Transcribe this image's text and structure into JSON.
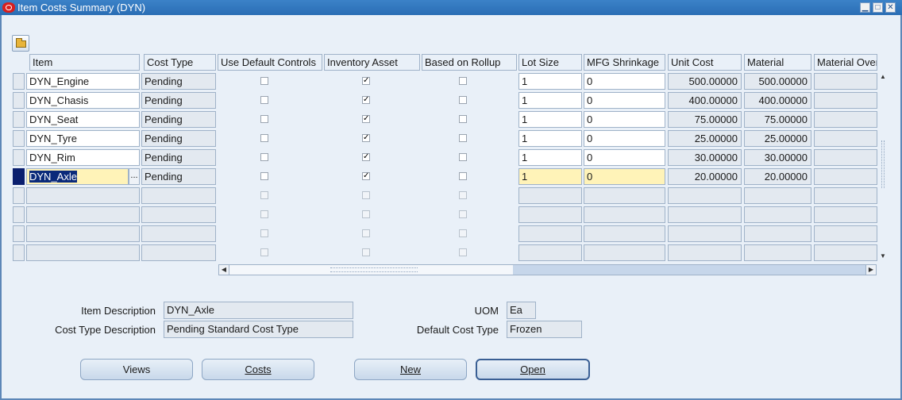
{
  "window": {
    "title": "Item Costs Summary (DYN)",
    "buttons": {
      "minimize": "▁",
      "maximize": "□",
      "close": "✕"
    }
  },
  "toolbar": {
    "open_folder_icon": "folder-open-icon"
  },
  "grid": {
    "headers": {
      "item": "Item",
      "cost_type": "Cost Type",
      "use_default_controls": "Use Default Controls",
      "inventory_asset": "Inventory Asset",
      "based_on_rollup": "Based on Rollup",
      "lot_size": "Lot Size",
      "mfg_shrinkage": "MFG Shrinkage",
      "unit_cost": "Unit Cost",
      "material": "Material",
      "material_overhead": "Material Over"
    },
    "rows": [
      {
        "item": "DYN_Engine",
        "cost_type": "Pending",
        "use_default_controls": false,
        "inventory_asset": true,
        "based_on_rollup": false,
        "lot_size": "1",
        "mfg_shrinkage": "0",
        "unit_cost": "500.00000",
        "material": "500.00000",
        "material_overhead": ""
      },
      {
        "item": "DYN_Chasis",
        "cost_type": "Pending",
        "use_default_controls": false,
        "inventory_asset": true,
        "based_on_rollup": false,
        "lot_size": "1",
        "mfg_shrinkage": "0",
        "unit_cost": "400.00000",
        "material": "400.00000",
        "material_overhead": ""
      },
      {
        "item": "DYN_Seat",
        "cost_type": "Pending",
        "use_default_controls": false,
        "inventory_asset": true,
        "based_on_rollup": false,
        "lot_size": "1",
        "mfg_shrinkage": "0",
        "unit_cost": "75.00000",
        "material": "75.00000",
        "material_overhead": ""
      },
      {
        "item": "DYN_Tyre",
        "cost_type": "Pending",
        "use_default_controls": false,
        "inventory_asset": true,
        "based_on_rollup": false,
        "lot_size": "1",
        "mfg_shrinkage": "0",
        "unit_cost": "25.00000",
        "material": "25.00000",
        "material_overhead": ""
      },
      {
        "item": "DYN_Rim",
        "cost_type": "Pending",
        "use_default_controls": false,
        "inventory_asset": true,
        "based_on_rollup": false,
        "lot_size": "1",
        "mfg_shrinkage": "0",
        "unit_cost": "30.00000",
        "material": "30.00000",
        "material_overhead": ""
      },
      {
        "item": "DYN_Axle",
        "cost_type": "Pending",
        "use_default_controls": false,
        "inventory_asset": true,
        "based_on_rollup": false,
        "lot_size": "1",
        "mfg_shrinkage": "0",
        "unit_cost": "20.00000",
        "material": "20.00000",
        "material_overhead": ""
      }
    ],
    "current_row": 6,
    "empty_rows": 4,
    "lov_button": "..."
  },
  "details": {
    "item_description_label": "Item Description",
    "item_description": "DYN_Axle",
    "cost_type_description_label": "Cost Type Description",
    "cost_type_description": "Pending Standard Cost Type",
    "uom_label": "UOM",
    "uom": "Ea",
    "default_cost_type_label": "Default Cost Type",
    "default_cost_type": "Frozen"
  },
  "buttons": {
    "views": "Views",
    "costs": "Costs",
    "new": "New",
    "open": "Open"
  },
  "scroll_arrows": {
    "up": "▲",
    "down": "▼",
    "left": "◀",
    "right": "▶"
  }
}
